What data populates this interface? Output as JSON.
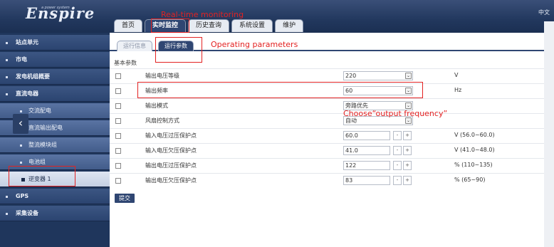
{
  "header": {
    "logo": "Enspire",
    "logo_sub": "a power system",
    "lang": "中文"
  },
  "tabs": [
    {
      "label": "首页"
    },
    {
      "label": "实时监控",
      "active": true
    },
    {
      "label": "历史查询"
    },
    {
      "label": "系统设置"
    },
    {
      "label": "维护"
    }
  ],
  "sidebar": {
    "items": [
      {
        "label": "站点单元"
      },
      {
        "label": "市电"
      },
      {
        "label": "发电机组概要"
      },
      {
        "label": "直流电器"
      },
      {
        "label": "交流配电"
      },
      {
        "label": "直流输出配电"
      },
      {
        "label": "整流模块组"
      },
      {
        "label": "电池组"
      },
      {
        "label": "逆变器 1"
      },
      {
        "label": "GPS"
      },
      {
        "label": "采集设备"
      }
    ]
  },
  "subtabs": [
    {
      "label": "运行信息"
    },
    {
      "label": "运行参数",
      "active": true
    }
  ],
  "section_title": "基本参数",
  "params": [
    {
      "name": "输出电压等级",
      "type": "select",
      "value": "220",
      "unit": "V"
    },
    {
      "name": "输出频率",
      "type": "select",
      "value": "60",
      "unit": "Hz"
    },
    {
      "name": "输出模式",
      "type": "select",
      "value": "旁路优先",
      "unit": ""
    },
    {
      "name": "风扇控制方式",
      "type": "select",
      "value": "自动",
      "unit": ""
    },
    {
      "name": "输入电压过压保护点",
      "type": "number",
      "value": "60.0",
      "unit": "V (56.0~60.0)"
    },
    {
      "name": "输入电压欠压保护点",
      "type": "number",
      "value": "41.0",
      "unit": "V (41.0~48.0)"
    },
    {
      "name": "输出电压过压保护点",
      "type": "number",
      "value": "122",
      "unit": "% (110~135)"
    },
    {
      "name": "输出电压欠压保护点",
      "type": "number",
      "value": "83",
      "unit": "% (65~90)"
    }
  ],
  "submit_label": "提交",
  "annotations": {
    "realtime": "Real-time monitoring",
    "operating": "Operating parameters",
    "choose": "Choose“output frequency”",
    "color": "#e32222"
  },
  "icons": {
    "stepper_minus": "-",
    "stepper_plus": "+",
    "chevron": "⌄",
    "collapse": "‹"
  }
}
